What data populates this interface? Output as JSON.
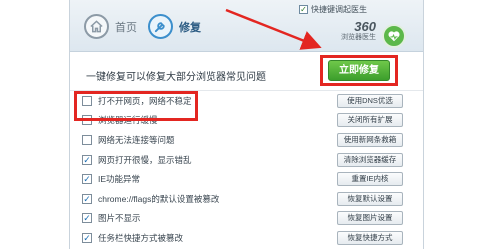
{
  "header": {
    "tabs": [
      {
        "label": "首页",
        "icon": "home-icon"
      },
      {
        "label": "修复",
        "icon": "wrench-icon"
      }
    ],
    "auto_start_label": "快捷键调起医生",
    "auto_start_checked": true,
    "brand_number": "360",
    "brand_name": "浏览器医生"
  },
  "main": {
    "headline": "一键修复可以修复大部分浏览器常见问题",
    "repair_button": "立即修复",
    "items": [
      {
        "label": "打不开网页，网络不稳定",
        "checked": false,
        "action": "使用DNS优选"
      },
      {
        "label": "浏览器运行缓慢",
        "checked": false,
        "action": "关闭所有扩展"
      },
      {
        "label": "网络无法连接等问题",
        "checked": false,
        "action": "使用新网条救箱"
      },
      {
        "label": "网页打开很慢，显示错乱",
        "checked": true,
        "action": "清除浏览器缓存"
      },
      {
        "label": "IE功能异常",
        "checked": true,
        "action": "重置IE内核"
      },
      {
        "label": "chrome://flags的默认设置被篡改",
        "checked": true,
        "action": "恢复默认设置"
      },
      {
        "label": "图片不显示",
        "checked": true,
        "action": "恢复图片设置"
      },
      {
        "label": "任务栏快捷方式被篡改",
        "checked": true,
        "action": "恢复快捷方式"
      }
    ]
  },
  "colors": {
    "accent_red": "#e32621",
    "button_green": "#3c9e2c",
    "header_bg": "#dde7ef"
  }
}
